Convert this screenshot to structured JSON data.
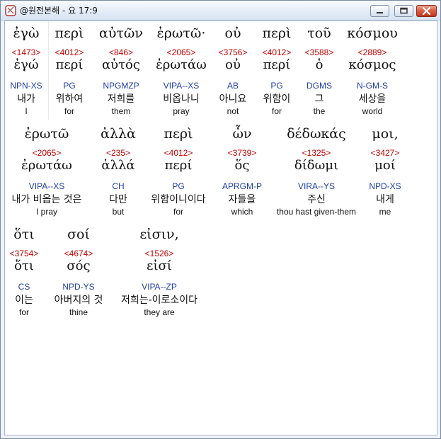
{
  "window": {
    "title": "@원전본해 - 요 17:9",
    "controls": {
      "minimize_icon": "minimize-icon",
      "maximize_icon": "maximize-icon",
      "close_icon": "close-icon"
    },
    "colors": {
      "strong_number": "#c00000",
      "morphology": "#1f3fa8",
      "text": "#111111"
    }
  },
  "verse": {
    "rows": [
      {
        "words": [
          {
            "greek": "ἐγὼ",
            "strong": "<1473>",
            "lemma": "ἐγώ",
            "morph": "NPN-XS",
            "korean": "내가",
            "english": "I"
          },
          {
            "greek": "περὶ",
            "strong": "<4012>",
            "lemma": "περί",
            "morph": "PG",
            "korean": "위하여",
            "english": "for"
          },
          {
            "greek": "αὐτῶν",
            "strong": "<846>",
            "lemma": "αὐτός",
            "morph": "NPGMZP",
            "korean": "저희를",
            "english": "them"
          },
          {
            "greek": "ἐρωτῶ·",
            "strong": "<2065>",
            "lemma": "ἐρωτάω",
            "morph": "VIPA--XS",
            "korean": "비옵나니",
            "english": "pray"
          },
          {
            "greek": "οὐ",
            "strong": "<3756>",
            "lemma": "οὐ",
            "morph": "AB",
            "korean": "아니요",
            "english": "not"
          },
          {
            "greek": "περὶ",
            "strong": "<4012>",
            "lemma": "περί",
            "morph": "PG",
            "korean": "위함이",
            "english": "for"
          },
          {
            "greek": "τοῦ",
            "strong": "<3588>",
            "lemma": "ὁ",
            "morph": "DGMS",
            "korean": "그",
            "english": "the"
          },
          {
            "greek": "κόσμου",
            "strong": "<2889>",
            "lemma": "κόσμος",
            "morph": "N-GM-S",
            "korean": "세상을",
            "english": "world"
          }
        ]
      },
      {
        "words": [
          {
            "greek": "ἐρωτῶ",
            "strong": "<2065>",
            "lemma": "ἐρωτάω",
            "morph": "VIPA--XS",
            "korean": "내가 비옵는 것은",
            "english": "I pray"
          },
          {
            "greek": "ἀλλὰ",
            "strong": "<235>",
            "lemma": "ἀλλά",
            "morph": "CH",
            "korean": "다만",
            "english": "but"
          },
          {
            "greek": "περὶ",
            "strong": "<4012>",
            "lemma": "περί",
            "morph": "PG",
            "korean": "위함이니이다",
            "english": "for"
          },
          {
            "greek": "ὧν",
            "strong": "<3739>",
            "lemma": "ὅς",
            "morph": "APRGM-P",
            "korean": "자들을",
            "english": "which"
          },
          {
            "greek": "δέδωκάς",
            "strong": "<1325>",
            "lemma": "δίδωμι",
            "morph": "VIRA--YS",
            "korean": "주신",
            "english": "thou hast given-them"
          },
          {
            "greek": "μοι,",
            "strong": "<3427>",
            "lemma": "μοί",
            "morph": "NPD-XS",
            "korean": "내게",
            "english": "me"
          }
        ]
      },
      {
        "words": [
          {
            "greek": "ὅτι",
            "strong": "<3754>",
            "lemma": "ὅτι",
            "morph": "CS",
            "korean": "이는",
            "english": "for"
          },
          {
            "greek": "σοί",
            "strong": "<4674>",
            "lemma": "σός",
            "morph": "NPD-YS",
            "korean": "아버지의 것",
            "english": "thine"
          },
          {
            "greek": "εἰσιν,",
            "strong": "<1526>",
            "lemma": "εἰσί",
            "morph": "VIPA--ZP",
            "korean": "저희는-이로소이다",
            "english": "they are"
          }
        ]
      }
    ]
  }
}
